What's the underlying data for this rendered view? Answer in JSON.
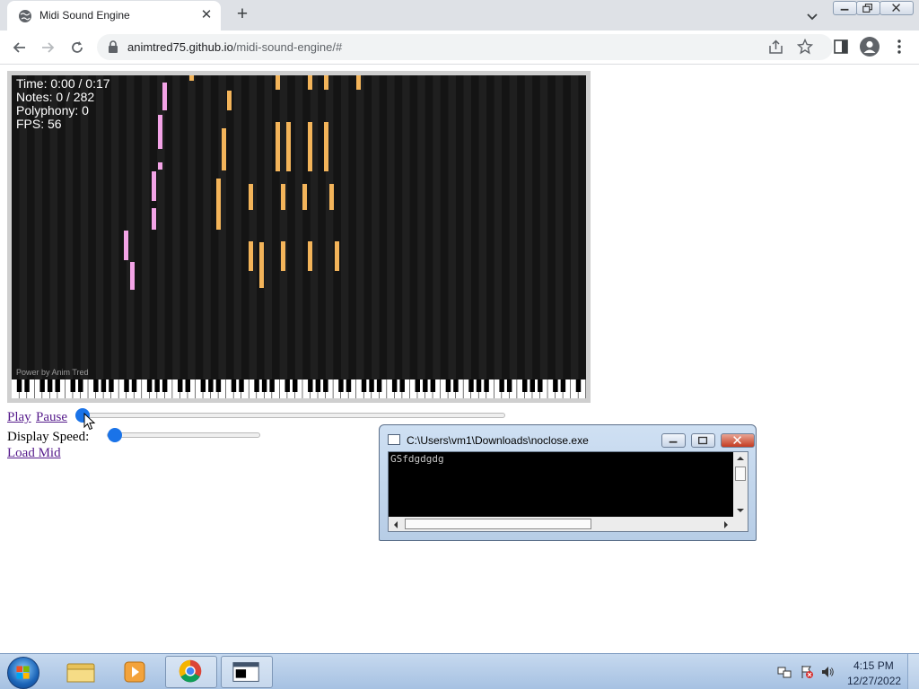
{
  "browser": {
    "tab_title": "Midi Sound Engine",
    "url_host": "animtred75.github.io",
    "url_path": "/midi-sound-engine/#"
  },
  "player": {
    "hud": [
      "Time: 0:00 / 0:17",
      "Notes: 0 / 282",
      "Polyphony: 0",
      "FPS: 56"
    ],
    "credit": "Power by Anim Tred",
    "play_label": "Play",
    "pause_label": "Pause",
    "speed_label": "Display Speed:",
    "load_label": "Load Mid",
    "seek_fraction": 0.0,
    "speed_fraction": 0.05
  },
  "console": {
    "title": "C:\\Users\\vm1\\Downloads\\noclose.exe",
    "output": "GSfdgdgdg"
  },
  "taskbar": {
    "apps": [
      "windows-explorer",
      "media-player",
      "google-chrome",
      "console"
    ],
    "time": "4:15 PM",
    "date": "12/27/2022"
  }
}
